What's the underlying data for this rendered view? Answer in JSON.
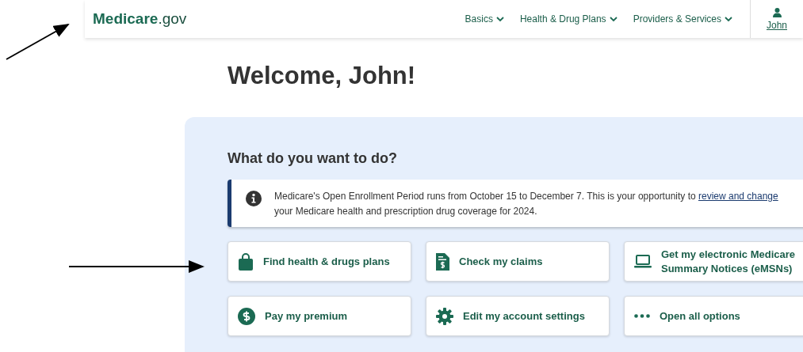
{
  "header": {
    "logo_bold": "Medicare",
    "logo_rest": ".gov",
    "nav": [
      "Basics",
      "Health & Drug Plans",
      "Providers & Services"
    ],
    "user": "John"
  },
  "welcome": "Welcome, John!",
  "tasks": {
    "heading": "What do you want to do?",
    "alert": {
      "text": "Medicare's Open Enrollment Period runs from October 15 to December 7. This is your opportunity to",
      "link": "review and change",
      "text_after": "your Medicare health and prescription drug coverage for 2024."
    },
    "actions": [
      {
        "label": "Find health & drugs plans"
      },
      {
        "label": "Check my claims"
      },
      {
        "label": "Get my electronic Medicare Summary Notices (eMSNs)"
      },
      {
        "label": "Pay my premium"
      },
      {
        "label": "Edit my account settings"
      },
      {
        "label": "Open all options"
      }
    ]
  }
}
